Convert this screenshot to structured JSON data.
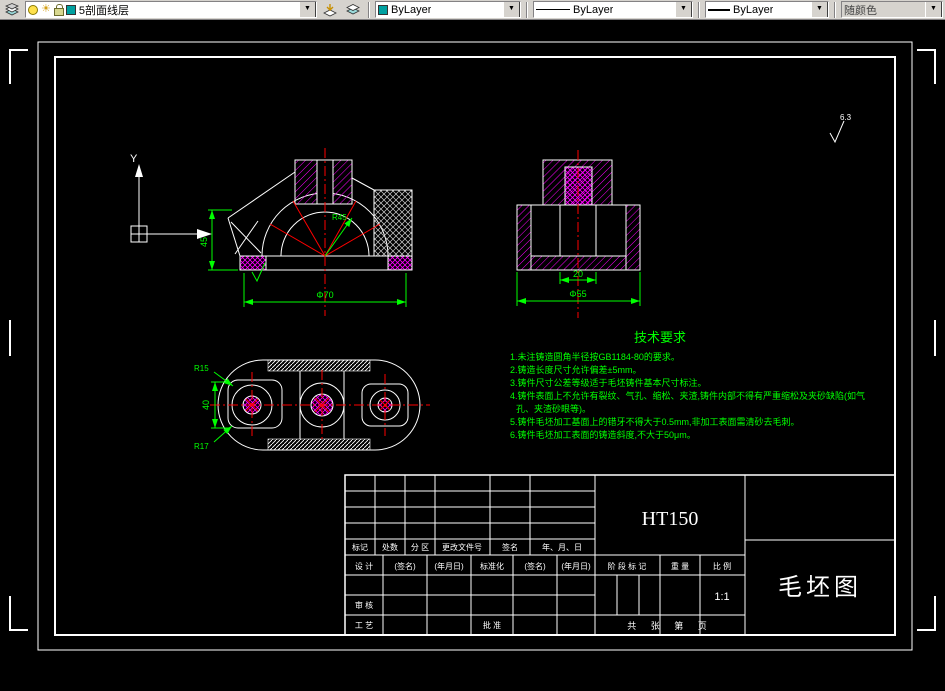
{
  "toolbar": {
    "layer": "5剖面线层",
    "color": "ByLayer",
    "linetype": "ByLayer",
    "lineweight": "ByLayer",
    "plot_style": "随颜色",
    "icons": {
      "dropdown": "▼",
      "sun": "☀"
    }
  },
  "drawing": {
    "ucs_y_label": "Y",
    "roughness_value": "6.3",
    "dims": {
      "front_height": "45",
      "front_width": "Φ70",
      "front_radius": "R45",
      "side_inner": "20",
      "side_width": "Φ55",
      "top_r_small": "R15",
      "top_r_big": "R17",
      "top_height": "40"
    },
    "tech": {
      "title": "技术要求",
      "lines": [
        "1.未注铸造圆角半径按GB1184-80的要求。",
        "2.铸造长度尺寸允许偏差±5mm。",
        "3.铸件尺寸公差等级适于毛坯铸件基本尺寸标注。",
        "4.铸件表面上不允许有裂纹、气孔、缩松、夹渣,铸件内部不得有严重缩松及夹砂缺陷(如气",
        "孔、夹渣砂眼等)。",
        "5.铸件毛坯加工基面上的错牙不得大于0.5mm,非加工表面需清砂去毛刺。",
        "6.铸件毛坯加工表面的铸造斜度,不大于50μm。"
      ]
    },
    "title_block": {
      "material": "HT150",
      "title": "毛坯图",
      "scale": "1:1",
      "labels": {
        "rev_mark": "标记",
        "rev_count": "处数",
        "rev_zone": "分 区",
        "rev_file": "更改文件号",
        "rev_sign": "签名",
        "rev_date": "年、月、日",
        "design": "设 计",
        "sign": "(签名)",
        "date": "(年月日)",
        "standardize": "标准化",
        "audit": "审 核",
        "craft": "工 艺",
        "approve": "批 准",
        "stage": "阶 段 标 记",
        "weight": "重 量",
        "scale_label": "比 例",
        "pages": "共 张 第 页"
      }
    }
  }
}
